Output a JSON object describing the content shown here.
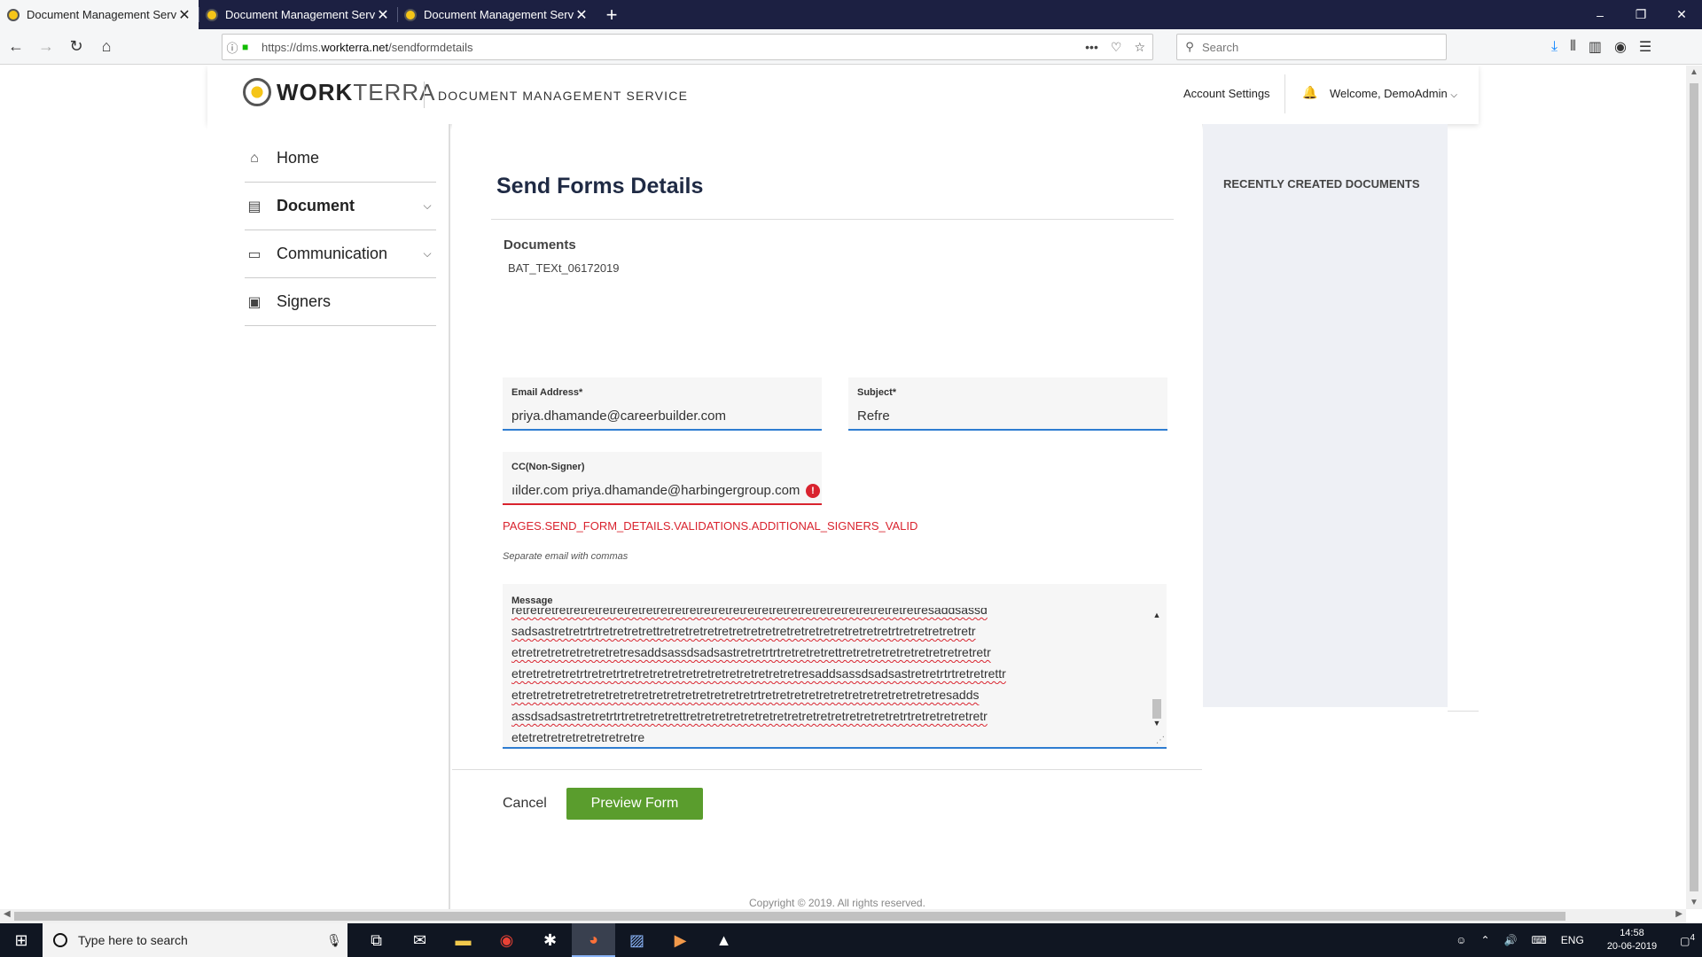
{
  "browser": {
    "tabs": [
      {
        "title": "Document Management Servic",
        "active": true
      },
      {
        "title": "Document Management Servic",
        "active": false
      },
      {
        "title": "Document Management Servic",
        "active": false
      }
    ],
    "url_prefix": "https://dms.",
    "url_domain": "workterra.net",
    "url_path": "/sendformdetails",
    "search_placeholder": "Search"
  },
  "header": {
    "brand_bold": "WORK",
    "brand_light": "TERRA",
    "service_name": "DOCUMENT MANAGEMENT SERVICE",
    "account_settings": "Account Settings",
    "welcome": "Welcome, DemoAdmin"
  },
  "sidebar": {
    "items": [
      {
        "label": "Home",
        "icon": "home-icon"
      },
      {
        "label": "Document",
        "icon": "document-icon"
      },
      {
        "label": "Communication",
        "icon": "chat-icon"
      },
      {
        "label": "Signers",
        "icon": "signer-icon"
      }
    ]
  },
  "main": {
    "title": "Send Forms Details",
    "documents_label": "Documents",
    "document_value": "BAT_TEXt_06172019",
    "email": {
      "label": "Email Address*",
      "value": "priya.dhamande@careerbuilder.com"
    },
    "subject": {
      "label": "Subject*",
      "value": "Refre"
    },
    "cc": {
      "label": "CC(Non-Signer)",
      "value": "ıilder.com priya.dhamande@harbingergroup.com"
    },
    "error_message": "PAGES.SEND_FORM_DETAILS.VALIDATIONS.ADDITIONAL_SIGNERS_VALID",
    "hint": "Separate email with commas",
    "message": {
      "label": "Message",
      "lines": [
        "retretretretretretretretretretretretretretretretretretretretretretretretretretretretresaddsassd",
        "sadsastretretrtrtretretretrettretretretretretretretretretretretretretretretretrtretretretretretr",
        "etretretretretretretretresaddsassdsadsastretretrtrtretretretrettretretretretretretretretretretr",
        "etretretretretrtretretrtretretretretretretretretretretretretresaddsassdsadsastretretrtrtretretrettr",
        "etretretretretretretretretretretretretretretretretrtretretretretretretretretretretretretresadds",
        "assdsadsastretretrtrtretretretrettretretretretretretretretretretretretretretretrtretretretretretr",
        "etetretretretretretretretre"
      ]
    },
    "cancel_label": "Cancel",
    "preview_label": "Preview Form"
  },
  "right_panel": {
    "title": "RECENTLY CREATED DOCUMENTS"
  },
  "footer": {
    "copyright": "Copyright © 2019. All rights reserved."
  },
  "taskbar": {
    "search_placeholder": "Type here to search",
    "language": "ENG",
    "time": "14:58",
    "date": "20-06-2019",
    "notifications": "4"
  },
  "colors": {
    "accent": "#2e7dd1",
    "error": "#d9232e",
    "primary_button": "#5a9d2d"
  }
}
